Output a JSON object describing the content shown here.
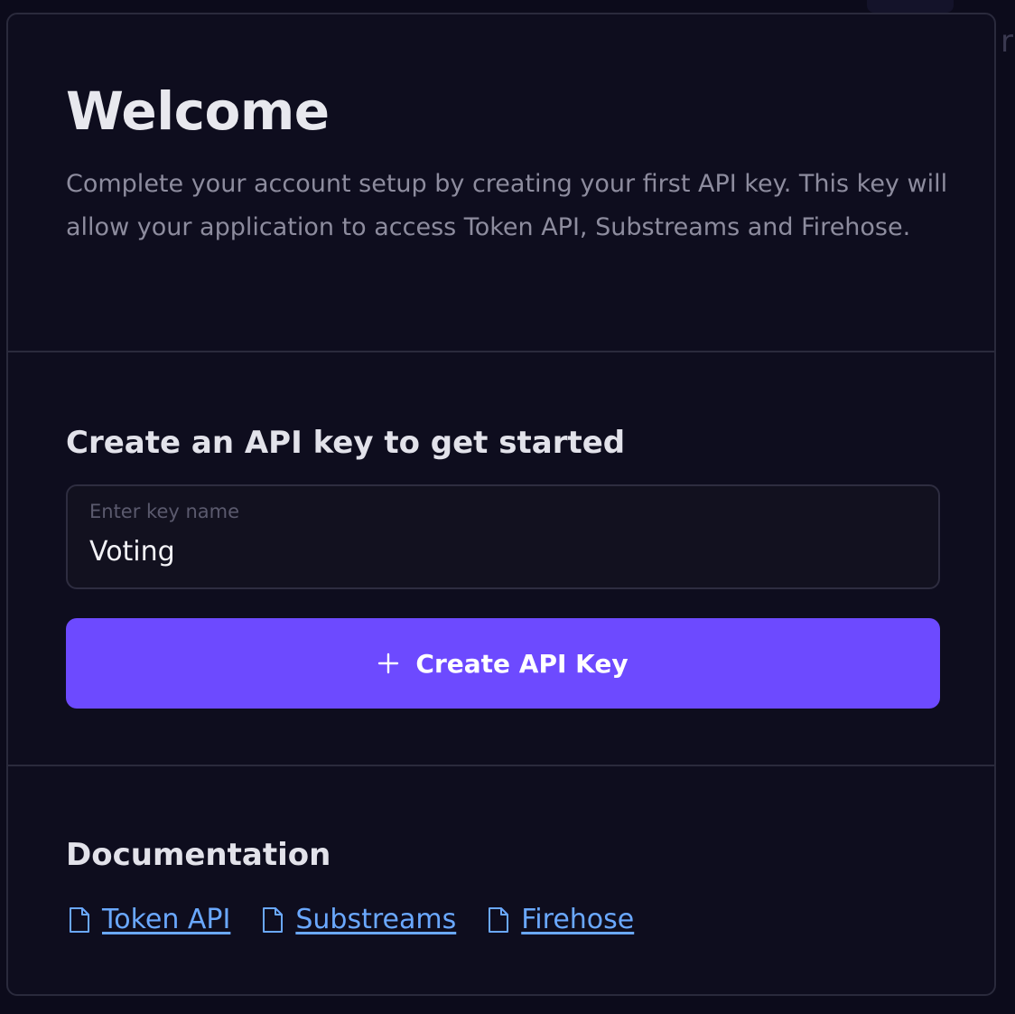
{
  "welcome": {
    "title": "Welcome",
    "subtitle": "Complete your account setup by creating your first API key. This key will allow your application to access Token API, Substreams and Firehose."
  },
  "create_key": {
    "heading": "Create an API key to get started",
    "field_label": "Enter key name",
    "field_value": "Voting",
    "button_label": "Create API Key",
    "button_icon": "plus-icon",
    "accent_color": "#6d4aff"
  },
  "docs": {
    "heading": "Documentation",
    "link_icon": "document-icon",
    "link_color": "#6aa8ff",
    "links": [
      {
        "label": "Token API"
      },
      {
        "label": "Substreams"
      },
      {
        "label": "Firehose"
      }
    ]
  }
}
